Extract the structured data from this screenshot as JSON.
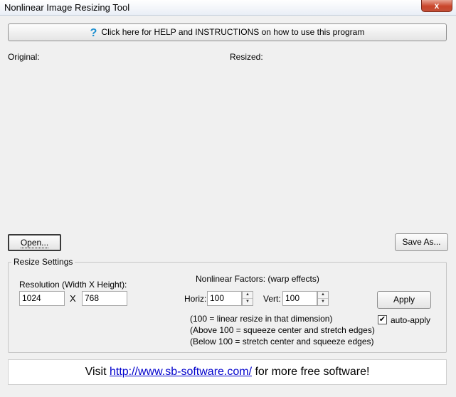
{
  "window": {
    "title": "Nonlinear Image Resizing Tool",
    "close_label": "x"
  },
  "help": {
    "label": "Click here for HELP and INSTRUCTIONS on how to use this program",
    "icon": "help-question-icon",
    "icon_glyph": "?"
  },
  "panes": {
    "original_label": "Original:",
    "resized_label": "Resized:"
  },
  "buttons": {
    "open": "Open...",
    "save_as": "Save As...",
    "apply": "Apply"
  },
  "resize_settings": {
    "title": "Resize Settings",
    "resolution_label": "Resolution (Width X Height):",
    "width": "1024",
    "times": "X",
    "height": "768",
    "nonlinear_label": "Nonlinear Factors: (warp effects)",
    "horiz_label": "Horiz:",
    "horiz_value": "100",
    "vert_label": "Vert:",
    "vert_value": "100",
    "note1": "(100 = linear  resize in that dimension)",
    "note2": "(Above 100 = squeeze center and stretch edges)",
    "note3": "(Below 100 = stretch center and squeeze edges)",
    "auto_apply_label": "auto-apply",
    "auto_apply_checked": true,
    "check_glyph": "✔"
  },
  "footer": {
    "prefix": "Visit ",
    "link": "http://www.sb-software.com/",
    "suffix": " for more free software!"
  }
}
